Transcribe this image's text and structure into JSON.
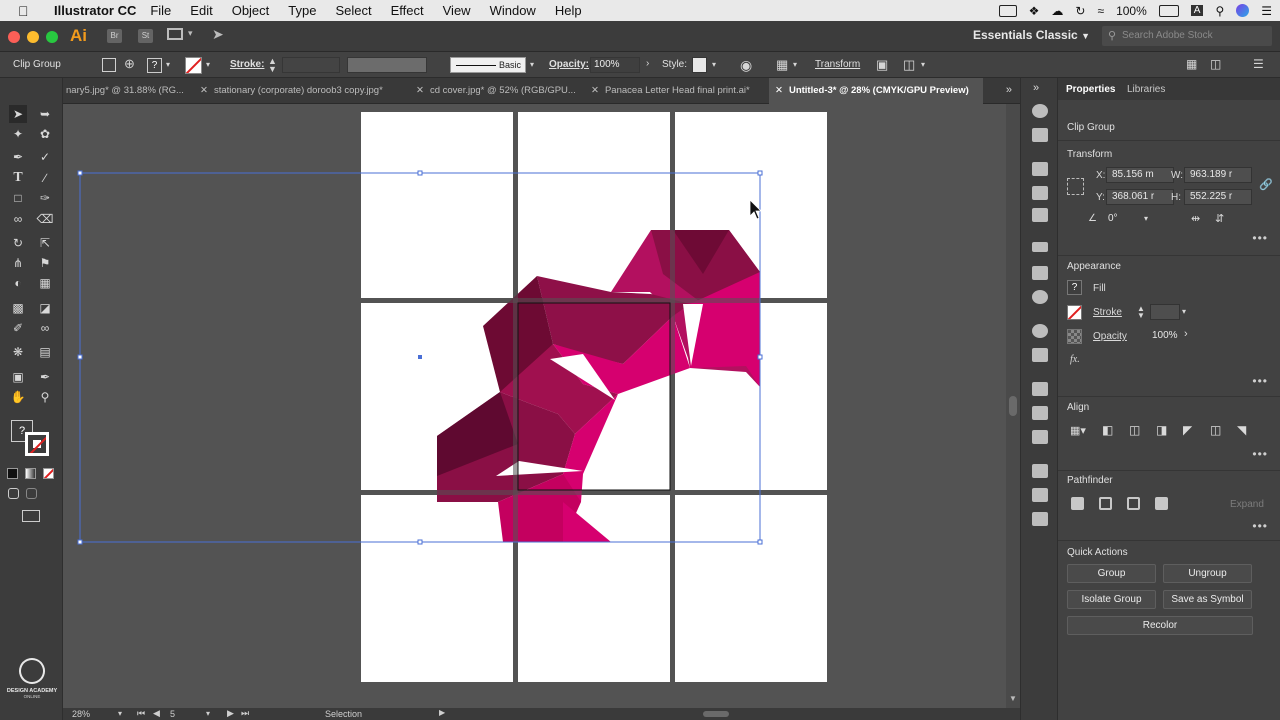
{
  "menubar": {
    "app_name": "Illustrator CC",
    "items": [
      "File",
      "Edit",
      "Object",
      "Type",
      "Select",
      "Effect",
      "View",
      "Window",
      "Help"
    ],
    "battery": "100%"
  },
  "appbar": {
    "logo": "Ai",
    "bridge_label": "Br",
    "stock_label": "St",
    "workspace": "Essentials Classic",
    "search_placeholder": "Search Adobe Stock"
  },
  "controlbar": {
    "selection_type": "Clip Group",
    "stroke_label": "Stroke:",
    "brush_label": "Basic",
    "opacity_label": "Opacity:",
    "opacity_value": "100%",
    "style_label": "Style:",
    "transform_label": "Transform"
  },
  "tabs": [
    {
      "label": "nary5.jpg* @ 31.88% (RG...",
      "active": false
    },
    {
      "label": "stationary (corporate) doroob3 copy.jpg*",
      "active": false
    },
    {
      "label": "cd cover.jpg* @ 52% (RGB/GPU...",
      "active": false
    },
    {
      "label": "Panacea Letter Head final print.ai*",
      "active": false
    },
    {
      "label": "Untitled-3* @ 28% (CMYK/GPU Preview)",
      "active": true
    }
  ],
  "statusbar": {
    "zoom": "28%",
    "artboard_number": "5",
    "tool_name": "Selection"
  },
  "properties": {
    "tab_properties": "Properties",
    "tab_libraries": "Libraries",
    "selection_type": "Clip Group",
    "transform_title": "Transform",
    "x_label": "X:",
    "x_value": "85.156 m",
    "y_label": "Y:",
    "y_value": "368.061 r",
    "w_label": "W:",
    "w_value": "963.189 r",
    "h_label": "H:",
    "h_value": "552.225 r",
    "angle_value": "0°",
    "appearance_title": "Appearance",
    "fill_label": "Fill",
    "stroke_label": "Stroke",
    "opacity_label": "Opacity",
    "opacity_value": "100%",
    "fx_label": "fx.",
    "align_title": "Align",
    "pathfinder_title": "Pathfinder",
    "expand_label": "Expand",
    "quick_actions_title": "Quick Actions",
    "group_btn": "Group",
    "ungroup_btn": "Ungroup",
    "isolate_btn": "Isolate Group",
    "save_symbol_btn": "Save as Symbol",
    "recolor_btn": "Recolor"
  },
  "watermark": {
    "line1": "DESIGN ACADEMY",
    "line2": "ONLINE"
  },
  "colors": {
    "magenta": "#d6006f",
    "wine": "#7a0d3e",
    "selection_blue": "#4a6fd6",
    "orange_ai": "#f29b1d"
  }
}
